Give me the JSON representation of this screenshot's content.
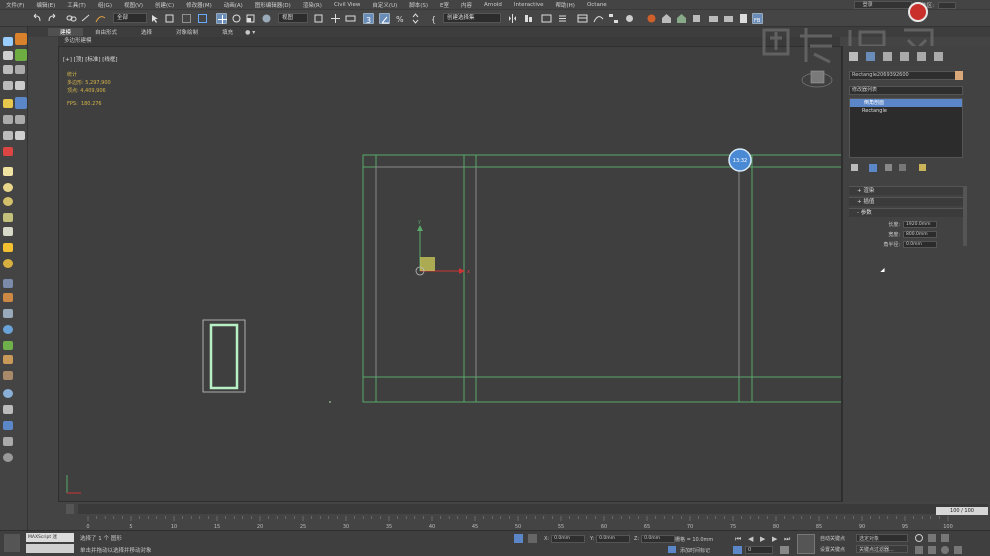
{
  "menubar": {
    "items": [
      "文件(F)",
      "编辑(E)",
      "工具(T)",
      "组(G)",
      "视图(V)",
      "创建(C)",
      "修改器(M)",
      "动画(A)",
      "图形编辑器(D)",
      "渲染(R)",
      "Civil View",
      "自定义(U)",
      "脚本(S)",
      "E室",
      "内容",
      "Arnold",
      "Interactive",
      "帮助(H)",
      "Octane"
    ],
    "login": "登录",
    "workspace_label": "工作区:"
  },
  "toolbar": {
    "filter_select": "全部",
    "view_select": "视图",
    "selection_set": "创建选择集"
  },
  "ribbon": {
    "tabs": [
      "建模",
      "自由形式",
      "选择",
      "对象绘制",
      "填充"
    ],
    "active_tab": "建模",
    "sub_label": "多边形建模"
  },
  "viewport": {
    "label": "[+] [顶] [标准] [线框]",
    "stats": {
      "title": "统计",
      "polys_label": "多边形:",
      "polys_value": "5,297,900",
      "verts_label": "顶点:",
      "verts_value": "4,409,906"
    },
    "fps_label": "FPS:",
    "fps_value": "180.276",
    "timer_badge": "13:32",
    "axis_x": "x",
    "axis_y": "y"
  },
  "command_panel": {
    "object_name": "Rectangle2069392600",
    "object_color": "#d9a77a",
    "modifier_list_label": "修改器列表",
    "stack": [
      "倒角剖面",
      "Rectangle"
    ],
    "rollouts": [
      "渲染",
      "插值",
      "参数"
    ],
    "params": [
      {
        "label": "长度:",
        "value": "1920.0mm"
      },
      {
        "label": "宽度:",
        "value": "800.0mm"
      },
      {
        "label": "角半径:",
        "value": "0.0mm"
      }
    ]
  },
  "timeline": {
    "frame_display": "100 / 100",
    "ruler_ticks": [
      "0",
      "5",
      "10",
      "15",
      "20",
      "25",
      "30",
      "35",
      "40",
      "45",
      "50",
      "55",
      "60",
      "65",
      "70",
      "75",
      "80",
      "85",
      "90",
      "95",
      "100"
    ]
  },
  "statusbar": {
    "maxscript_label": "MAXScript 迷",
    "selection_status": "选择了 1 个 图形",
    "prompt": "单击并拖动以选择并移动对象",
    "x_label": "X:",
    "x_value": "0.0mm",
    "y_label": "Y:",
    "y_value": "0.0mm",
    "z_label": "Z:",
    "z_value": "0.0mm",
    "grid_label": "栅格 = 10.0mm",
    "add_time_tag": "添加时间标记",
    "auto_key": "自动关键点",
    "set_key": "设置关键点",
    "selected_object": "选定对象",
    "key_filters": "关键点过滤器...",
    "frame_value": "0"
  },
  "colors": {
    "viewport_bg": "#3f3f3f",
    "selected_line": "#b7f0c5",
    "shape_line": "#5aa86a",
    "accent_blue": "#5b87c8",
    "highlight": "#c9d4a0"
  }
}
